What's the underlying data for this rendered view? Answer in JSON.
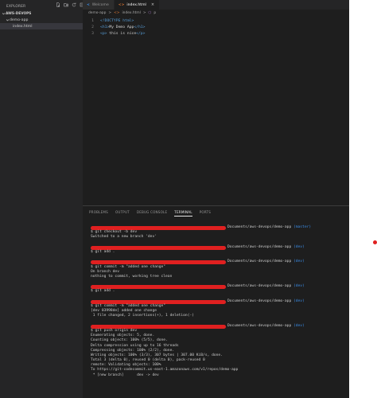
{
  "explorer": {
    "title": "EXPLORER",
    "root": "AWS-DEVOPS",
    "folder": "demo-app",
    "file": "index.html",
    "actions": [
      "new-file-icon",
      "new-folder-icon",
      "refresh-icon",
      "collapse-icon"
    ]
  },
  "tabs": [
    {
      "label": "Welcome",
      "icon": "vscode-icon",
      "active": false
    },
    {
      "label": "index.html",
      "icon": "html-icon",
      "active": true,
      "close": "×"
    }
  ],
  "breadcrumb": {
    "folder": "demo-app",
    "sep": ">",
    "file": "index.html",
    "symbol": "p"
  },
  "code": {
    "lines": [
      {
        "n": "1",
        "parts": [
          [
            "tag",
            "<!DOCTYPE html>"
          ]
        ]
      },
      {
        "n": "2",
        "parts": [
          [
            "tag",
            "<h1>"
          ],
          [
            "txt",
            "My Demo App"
          ],
          [
            "tag",
            "</h1>"
          ]
        ]
      },
      {
        "n": "3",
        "parts": [
          [
            "tag",
            "<p>"
          ],
          [
            "txt",
            " this is nice"
          ],
          [
            "tag",
            "</p>"
          ]
        ]
      }
    ]
  },
  "panel": {
    "tabs": [
      "PROBLEMS",
      "OUTPUT",
      "DEBUG CONSOLE",
      "TERMINAL",
      "PORTS"
    ],
    "active_tab": "TERMINAL"
  },
  "terminal": {
    "path_suffix": "Documents/aws-devops/demo-app",
    "lines": [
      {
        "kind": "prompt",
        "branch": "(master)"
      },
      {
        "kind": "cmd",
        "text": "$ git checkout -b dev"
      },
      {
        "kind": "out",
        "text": "Switched to a new branch 'dev'"
      },
      {
        "kind": "blank"
      },
      {
        "kind": "prompt",
        "branch": "(dev)"
      },
      {
        "kind": "cmd",
        "text": "$ git add ."
      },
      {
        "kind": "blank"
      },
      {
        "kind": "prompt",
        "branch": "(dev)"
      },
      {
        "kind": "cmd",
        "text": "$ git commit -m \"added one change\""
      },
      {
        "kind": "out",
        "text": "On branch dev"
      },
      {
        "kind": "out",
        "text": "nothing to commit, working tree clean"
      },
      {
        "kind": "blank"
      },
      {
        "kind": "prompt",
        "branch": "(dev)"
      },
      {
        "kind": "cmd",
        "text": "$ git add ."
      },
      {
        "kind": "blank"
      },
      {
        "kind": "prompt",
        "branch": "(dev)"
      },
      {
        "kind": "cmd",
        "text": "$ git commit -m \"added one change\""
      },
      {
        "kind": "out",
        "text": "[dev 03998de] added one change"
      },
      {
        "kind": "out",
        "text": " 1 file changed, 2 insertions(+), 1 deletion(-)"
      },
      {
        "kind": "blank"
      },
      {
        "kind": "prompt",
        "branch": "(dev)"
      },
      {
        "kind": "cmd",
        "text": "$ git push origin dev"
      },
      {
        "kind": "out",
        "text": "Enumerating objects: 5, done."
      },
      {
        "kind": "out",
        "text": "Counting objects: 100% (5/5), done."
      },
      {
        "kind": "out",
        "text": "Delta compression using up to 16 threads"
      },
      {
        "kind": "out",
        "text": "Compressing objects: 100% (2/2), done."
      },
      {
        "kind": "out",
        "text": "Writing objects: 100% (3/3), 307 bytes | 307.00 KiB/s, done."
      },
      {
        "kind": "out",
        "text": "Total 3 (delta 0), reused 0 (delta 0), pack-reused 0"
      },
      {
        "kind": "out",
        "text": "remote: Validating objects: 100%"
      },
      {
        "kind": "out",
        "text": "To https://git-codecommit.us-east-1.amazonaws.com/v1/repos/demo-app"
      },
      {
        "kind": "out",
        "text": " * [new branch]      dev -> dev"
      }
    ]
  },
  "colors": {
    "sidebar_bg": "#252526",
    "editor_bg": "#1e1e1e",
    "branch": "#3b8eea",
    "redaction": "#e02020",
    "html_tag": "#569cd6"
  }
}
